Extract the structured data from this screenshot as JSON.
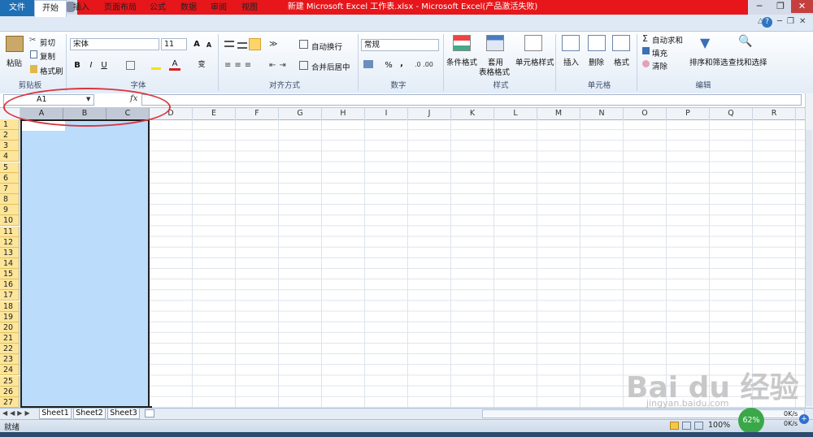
{
  "window": {
    "title": "新建 Microsoft Excel 工作表.xlsx  -  Microsoft Excel(产品激活失败)",
    "controls": [
      "─",
      "❐",
      "✕"
    ]
  },
  "tabs": [
    "文件",
    "开始",
    "插入",
    "页面布局",
    "公式",
    "数据",
    "审阅",
    "视图"
  ],
  "ribbon": {
    "clipboard": {
      "paste": "粘贴",
      "cut": "剪切",
      "copy": "复制",
      "format_painter": "格式刷",
      "label": "剪贴板"
    },
    "font": {
      "name": "宋体",
      "size": "11",
      "bold": "B",
      "italic": "I",
      "underline": "U",
      "grow": "A",
      "shrink": "A",
      "color": "A",
      "phonetic": "变",
      "label": "字体"
    },
    "alignment": {
      "wrap": "自动换行",
      "merge": "合并后居中",
      "label": "对齐方式"
    },
    "number": {
      "format": "常规",
      "percent": "%",
      "comma": ",",
      "label": "数字"
    },
    "styles": {
      "conditional": "条件格式",
      "table_1": "套用",
      "table_2": "表格格式",
      "cell_styles": "单元格样式",
      "label": "样式"
    },
    "cells": {
      "insert": "插入",
      "delete": "删除",
      "format": "格式",
      "label": "单元格"
    },
    "editing": {
      "autosum": "自动求和",
      "fill": "填充",
      "clear": "清除",
      "sort": "排序和筛选",
      "find": "查找和选择",
      "label": "编辑"
    }
  },
  "formula_bar": {
    "name_box": "A1",
    "fx": "fx",
    "value": ""
  },
  "columns": [
    "A",
    "B",
    "C",
    "D",
    "E",
    "F",
    "G",
    "H",
    "I",
    "J",
    "K",
    "L",
    "M",
    "N",
    "O",
    "P",
    "Q",
    "R"
  ],
  "rows": [
    "1",
    "2",
    "3",
    "4",
    "5",
    "6",
    "7",
    "8",
    "9",
    "10",
    "11",
    "12",
    "13",
    "14",
    "15",
    "16",
    "17",
    "18",
    "19",
    "20",
    "21",
    "22",
    "23",
    "24",
    "25",
    "26",
    "27"
  ],
  "sheets": [
    "Sheet1",
    "Sheet2",
    "Sheet3"
  ],
  "status": {
    "mode": "就绪",
    "zoom": "100%",
    "battery": "62%",
    "up": "0K/s",
    "down": "0K/s"
  },
  "watermark": {
    "brand": "Bai du 经验",
    "url": "jingyan.baidu.com"
  },
  "colors": {
    "title_red": "#e6161a",
    "file_tab": "#1f6fb5",
    "selection": "#bcdcfb",
    "row_header_selected": "#fde59a",
    "annotation": "#d9363e"
  }
}
